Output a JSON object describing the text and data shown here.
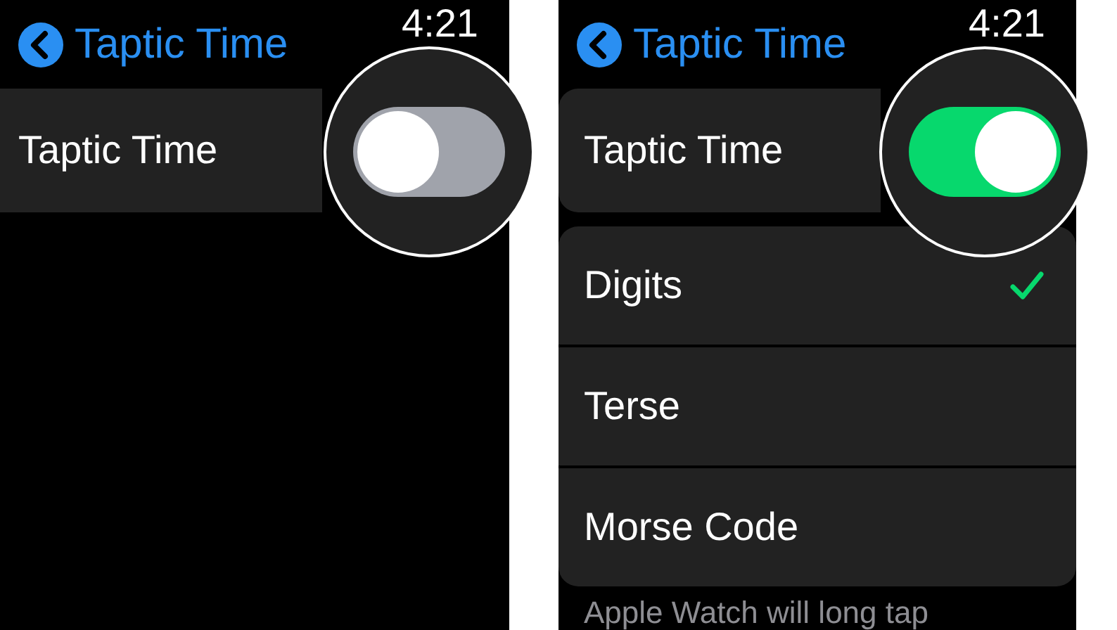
{
  "screens": [
    {
      "back_title": "Taptic Time",
      "time": "4:21",
      "toggle": {
        "label": "Taptic Time",
        "on": false
      }
    },
    {
      "back_title": "Taptic Time",
      "time": "4:21",
      "toggle": {
        "label": "Taptic Time",
        "on": true
      },
      "options": [
        {
          "label": "Digits",
          "selected": true
        },
        {
          "label": "Terse",
          "selected": false
        },
        {
          "label": "Morse Code",
          "selected": false
        }
      ],
      "footer": "Apple Watch will long tap"
    }
  ]
}
